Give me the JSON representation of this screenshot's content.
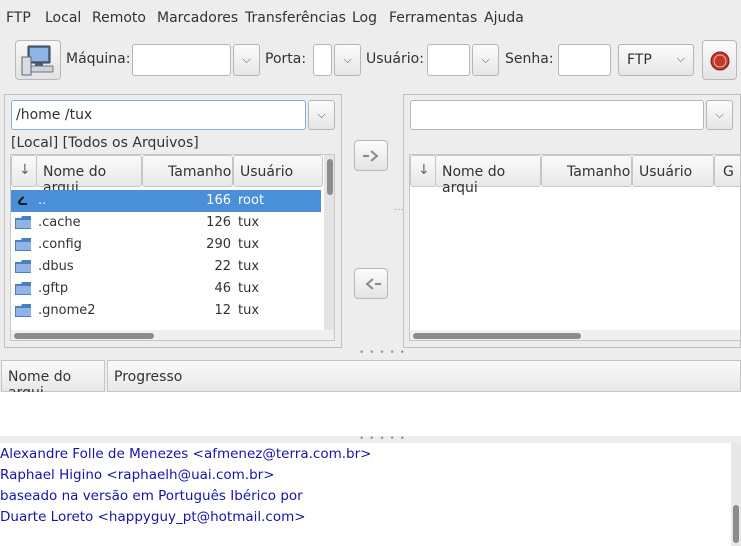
{
  "menu": [
    "FTP",
    "Local",
    "Remoto",
    "Marcadores",
    "Transferências",
    "Log",
    "Ferramentas",
    "Ajuda"
  ],
  "toolbar": {
    "host_label": "Máquina:",
    "port_label": "Porta:",
    "user_label": "Usuário:",
    "pass_label": "Senha:",
    "protocol": "FTP"
  },
  "local": {
    "path": "/home /tux",
    "filter": "[Local] [Todos os Arquivos]",
    "columns": [
      "Nome do arqui",
      "Tamanho",
      "Usuário"
    ],
    "rows": [
      {
        "name": "..",
        "size": "166",
        "user": "root"
      },
      {
        "name": ".cache",
        "size": "126",
        "user": "tux"
      },
      {
        "name": ".config",
        "size": "290",
        "user": "tux"
      },
      {
        "name": ".dbus",
        "size": "22",
        "user": "tux"
      },
      {
        "name": ".gftp",
        "size": "46",
        "user": "tux"
      },
      {
        "name": ".gnome2",
        "size": "12",
        "user": "tux"
      }
    ]
  },
  "remote": {
    "path": "",
    "columns": [
      "Nome do arqui",
      "Tamanho",
      "Usuário",
      "G"
    ]
  },
  "transfers": {
    "columns": [
      "Nome do arqui",
      "Progresso"
    ]
  },
  "log": [
    "Alexandre Folle de Menezes <afmenez@terra.com.br>",
    "Raphael Higino <raphaelh@uai.com.br>",
    "baseado na versão em Português Ibérico por",
    "Duarte Loreto <happyguy_pt@hotmail.com>"
  ],
  "colors": {
    "selection": "#4a90d9",
    "log_text": "#1515a8",
    "folder": "#4a7fc4"
  },
  "icons": [
    "computer-connect-icon",
    "stop-icon",
    "folder-icon",
    "up-folder-icon",
    "arrow-right-icon",
    "arrow-left-icon",
    "chevron-down-icon"
  ]
}
